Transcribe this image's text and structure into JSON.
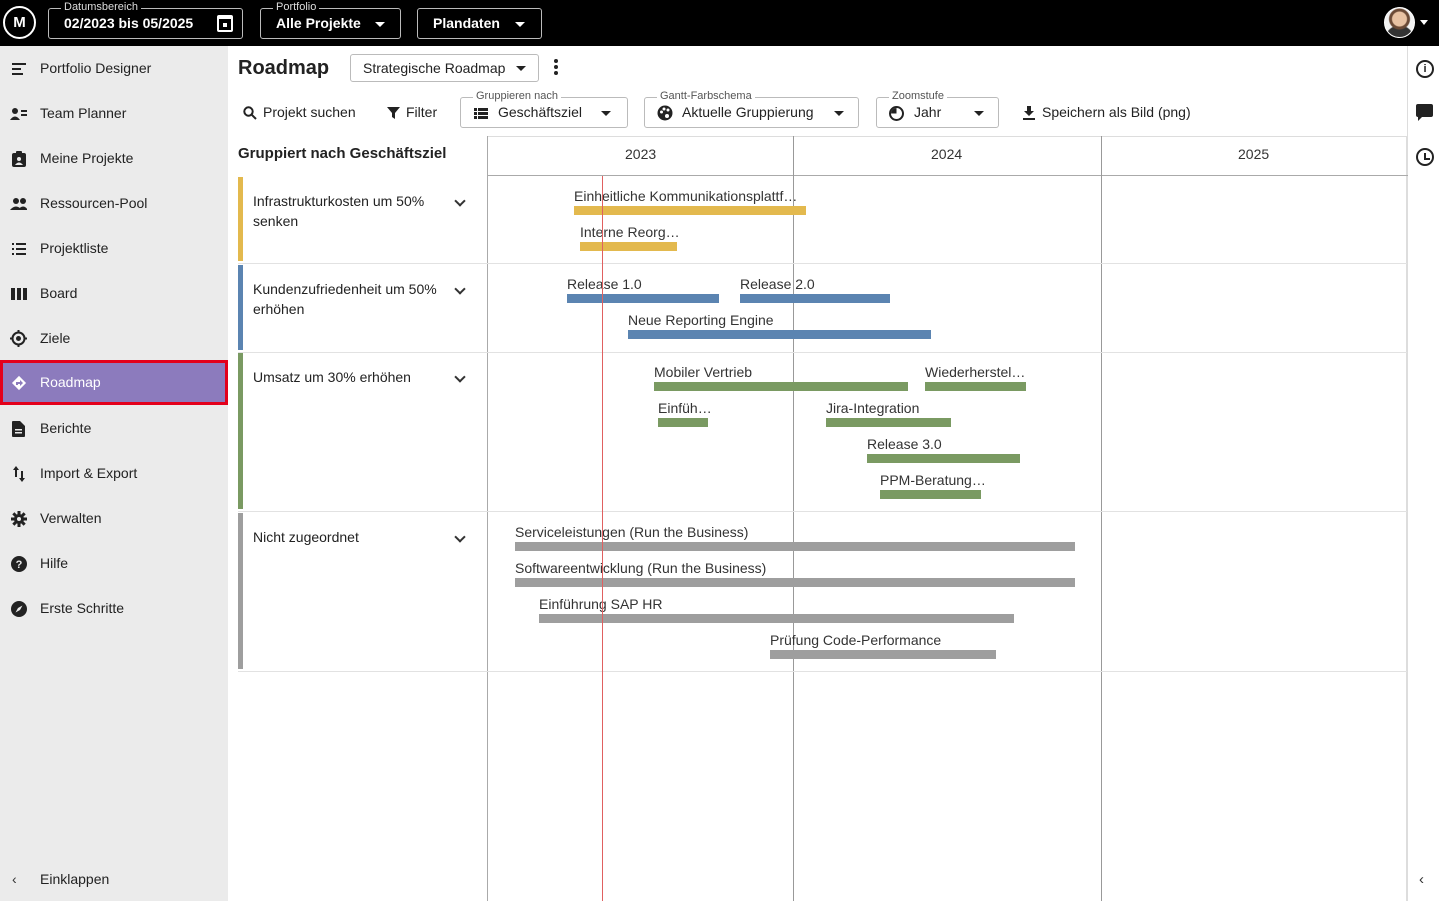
{
  "topbar": {
    "logo_text": "M",
    "date_range": {
      "legend": "Datumsbereich",
      "value": "02/2023 bis 05/2025"
    },
    "portfolio": {
      "legend": "Portfolio",
      "value": "Alle Projekte"
    },
    "data_mode": {
      "value": "Plandaten"
    }
  },
  "sidebar": {
    "items": [
      {
        "label": "Portfolio Designer",
        "icon": "portfolio-designer-icon"
      },
      {
        "label": "Team Planner",
        "icon": "team-planner-icon"
      },
      {
        "label": "Meine Projekte",
        "icon": "my-projects-icon"
      },
      {
        "label": "Ressourcen-Pool",
        "icon": "people-icon"
      },
      {
        "label": "Projektliste",
        "icon": "list-icon"
      },
      {
        "label": "Board",
        "icon": "board-icon"
      },
      {
        "label": "Ziele",
        "icon": "target-icon"
      },
      {
        "label": "Roadmap",
        "icon": "roadmap-icon",
        "active": true
      },
      {
        "label": "Berichte",
        "icon": "report-icon"
      },
      {
        "label": "Import & Export",
        "icon": "import-export-icon"
      },
      {
        "label": "Verwalten",
        "icon": "gear-icon"
      },
      {
        "label": "Hilfe",
        "icon": "help-icon"
      },
      {
        "label": "Erste Schritte",
        "icon": "compass-icon"
      }
    ],
    "collapse_label": "Einklappen"
  },
  "header": {
    "title": "Roadmap",
    "roadmap_select": "Strategische Roadmap"
  },
  "toolbar": {
    "search_label": "Projekt suchen",
    "filter_label": "Filter",
    "group_by": {
      "legend": "Gruppieren nach",
      "value": "Geschäftsziel"
    },
    "color_scheme": {
      "legend": "Gantt-Farbschema",
      "value": "Aktuelle Gruppierung"
    },
    "zoom": {
      "legend": "Zoomstufe",
      "value": "Jahr"
    },
    "save_image_label": "Speichern als Bild (png)"
  },
  "gantt": {
    "group_heading": "Gruppiert nach Geschäftsziel",
    "years": [
      "2023",
      "2024",
      "2025"
    ],
    "groups": [
      {
        "name": "Infrastrukturkosten um 50% senken",
        "color": "#e3b94e",
        "bars": [
          {
            "label": "Einheitliche Kommunikationsplattf…"
          },
          {
            "label": "Interne Reorg…"
          }
        ]
      },
      {
        "name": "Kundenzufriedenheit um 50% erhöhen",
        "color": "#5b84b1",
        "bars": [
          {
            "label": "Release 1.0"
          },
          {
            "label": "Release 2.0"
          },
          {
            "label": "Neue Reporting Engine"
          }
        ]
      },
      {
        "name": "Umsatz um 30% erhöhen",
        "color": "#7a9a62",
        "bars": [
          {
            "label": "Mobiler Vertrieb"
          },
          {
            "label": "Wiederherstel…"
          },
          {
            "label": "Einfüh…"
          },
          {
            "label": "Jira-Integration"
          },
          {
            "label": "Release 3.0"
          },
          {
            "label": "PPM-Beratung…"
          }
        ]
      },
      {
        "name": "Nicht zugeordnet",
        "color": "#9e9e9e",
        "bars": [
          {
            "label": "Serviceleistungen (Run the Business)"
          },
          {
            "label": "Softwareentwicklung (Run the Business)"
          },
          {
            "label": "Einführung SAP HR"
          },
          {
            "label": "Prüfung Code-Performance"
          }
        ]
      }
    ]
  }
}
